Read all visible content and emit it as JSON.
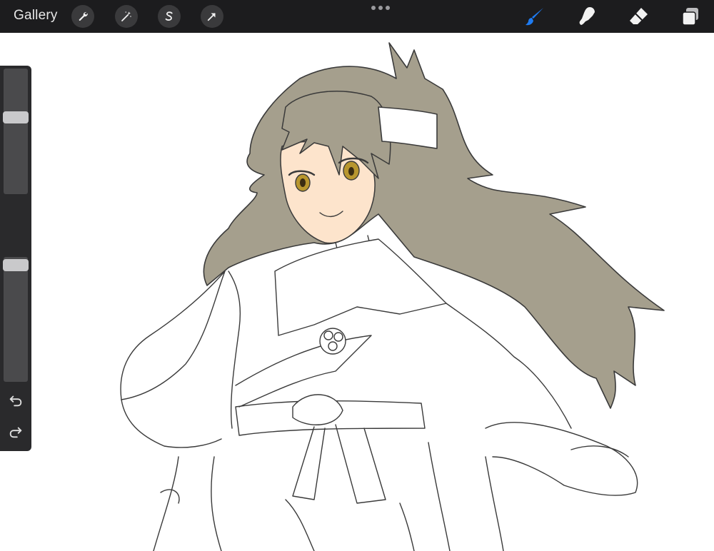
{
  "toolbar": {
    "gallery_label": "Gallery",
    "left_tools": [
      {
        "name": "actions",
        "icon": "wrench-icon"
      },
      {
        "name": "adjustments",
        "icon": "magic-wand-icon"
      },
      {
        "name": "selection",
        "icon": "selection-s-icon"
      },
      {
        "name": "transform",
        "icon": "arrow-cursor-icon"
      }
    ],
    "more_menu_icon": "three-dots-icon",
    "right_tools": [
      {
        "name": "brush",
        "icon": "brush-icon",
        "active": true
      },
      {
        "name": "smudge",
        "icon": "smudge-finger-icon",
        "active": false
      },
      {
        "name": "eraser",
        "icon": "eraser-icon",
        "active": false
      },
      {
        "name": "layers",
        "icon": "layers-icon",
        "active": false
      }
    ],
    "accent_color": "#1e7bf2",
    "bar_color": "#1c1c1e"
  },
  "sidebar": {
    "brush_size_level": 0.62,
    "opacity_level": 0.98,
    "modify_button_icon": "square-modify-icon",
    "undo_icon": "undo-icon",
    "redo_icon": "redo-icon"
  },
  "canvas": {
    "background_color": "#ffffff",
    "hair_color": "#a59f8d",
    "skin_color": "#fde4cc",
    "eye_color": "#b8962e",
    "line_color": "#3a3a3a"
  }
}
